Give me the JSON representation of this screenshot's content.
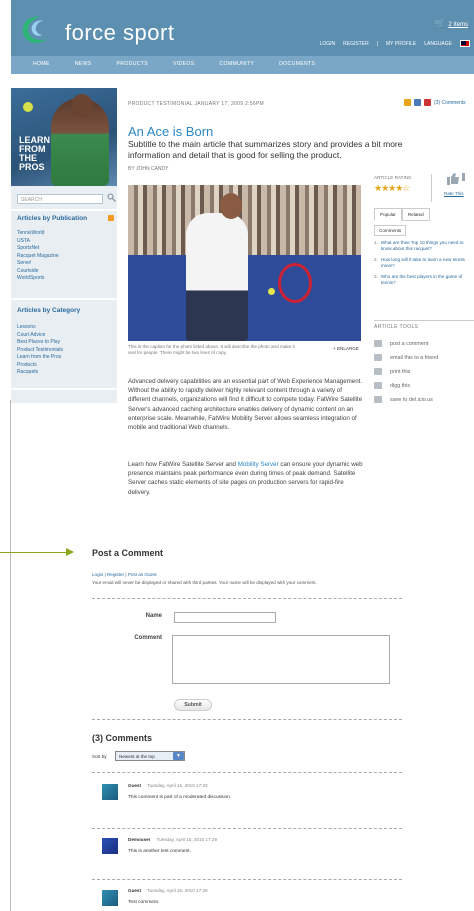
{
  "header": {
    "brand": "force sport",
    "cart": "2 Items",
    "toplinks": [
      "LOGIN",
      "REGISTER",
      "MY PROFILE",
      "LANGUAGE"
    ]
  },
  "nav": [
    "HOME",
    "NEWS",
    "PRODUCTS",
    "VIDEOS",
    "COMMUNITY",
    "DOCUMENTS"
  ],
  "sidebar": {
    "promo": [
      "LEARN",
      "FROM",
      "THE",
      "PROS"
    ],
    "search_placeholder": "SEARCH",
    "pub_heading": "Articles by Publication",
    "publications": [
      "TennisWorld",
      "USTA",
      "SportsNet",
      "Racquet Magazine",
      "Serve!",
      "Courtside",
      "WorldSports"
    ],
    "cat_heading": "Articles by Category",
    "categories": [
      "Lessons",
      "Court Advice",
      "Best Places to Play",
      "Product Testimonials",
      "Learn from the Pros",
      "Products",
      "Racquets"
    ]
  },
  "article": {
    "kicker": "PRODUCT TESTIMONIAL   JANUARY 17, 2009 2:56PM",
    "comments_link": "(3) Comments",
    "title": "An Ace is Born",
    "subtitle": "Subtitle to the main article that summarizes story and provides a bit more information and detail that is good for selling the product.",
    "byline": "BY JOHN CANDY",
    "caption": "This is the caption for the photo listed above. It will describe the photo and make it real for people. There might be two lines of copy.",
    "enlarge": "+ ENLARGE",
    "para1": "Advanced delivery capabilities are an essential part of Web Experience Management. Without the ability to rapidly deliver highly relevant content through a variety of different channels, organizations will find it difficult to compete today. FatWire Satellite Server's advanced caching architecture enables delivery of dynamic content on an enterprise scale. Meanwhile, FatWire Mobility Server allows seamless integration of mobile and traditional Web channels.",
    "para2_pre": "Learn how FatWire Satellite Server and ",
    "para2_link": "Mobility Server",
    "para2_post": " can ensure your dynamic web presence maintains peak performance even during times of peak demand. Satellite Server caches static elements of site pages on production servers for rapid-fire delivery."
  },
  "right": {
    "rating_label": "ARTICLE RATING",
    "stars": "★★★★☆",
    "rate_this": "Rate This",
    "tabs": [
      "Popular",
      "Related"
    ],
    "tab_comments": "Comments",
    "popular": [
      {
        "n": "1.",
        "text": "What are thee Top 10 things you need to know about this racquet?"
      },
      {
        "n": "2.",
        "text": "How long will it take to learn a new tennis move?"
      },
      {
        "n": "3.",
        "text": "Who are the best players in the game of tennis?"
      }
    ],
    "tools_label": "ARTICLE TOOLS",
    "tools": [
      "post a comment",
      "email this to a friend",
      "print this",
      "digg this",
      "save to del.icio.us"
    ]
  },
  "post": {
    "heading": "Post a Comment",
    "links": "Login | Register | Post as Guest",
    "privacy": "Your email will never be displayed or shared with third parties. Your name will be displayed with your comment.",
    "name_label": "Name",
    "comment_label": "Comment",
    "submit": "Submit"
  },
  "comments": {
    "heading": "(3) Comments",
    "sort_label": "Sort by",
    "sort_value": "Newest at the top",
    "items": [
      {
        "author": "Guest",
        "date": "Tuesday, April 15, 2010 17:33",
        "text": "This comment is part of a moderated discussion."
      },
      {
        "author": "Demouser",
        "date": "Tuesday, April 15, 2010 17:29",
        "text": "This is another test comment."
      },
      {
        "author": "Guest",
        "date": "Tuesday, April 15, 2010 17:29",
        "text": "Test comment."
      }
    ]
  },
  "colors": {
    "header": "#5d8fb0",
    "nav": "#7aa7c6",
    "link": "#2a86c4",
    "arrow": "#8aa51e"
  }
}
